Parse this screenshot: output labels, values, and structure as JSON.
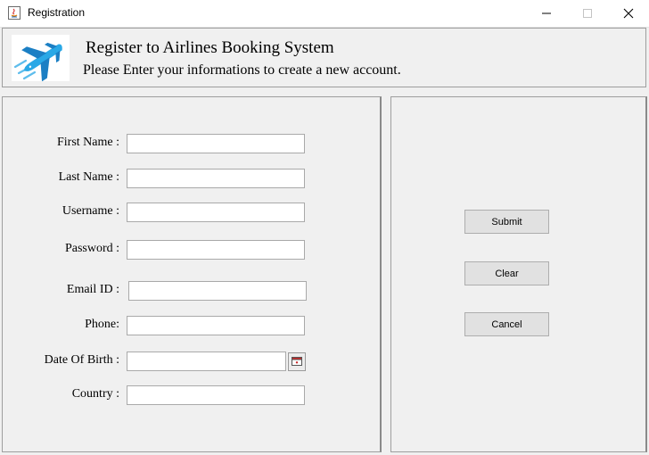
{
  "window": {
    "title": "Registration",
    "icons": {
      "app": "java-app-icon",
      "minimize": "minimize-icon",
      "maximize": "maximize-icon",
      "close": "close-icon"
    }
  },
  "header": {
    "logo": "airplane-logo",
    "title": "Register to Airlines Booking System",
    "subtitle": "Please Enter your informations to create a new account."
  },
  "form": {
    "fields": [
      {
        "label": "First Name :",
        "value": ""
      },
      {
        "label": "Last Name :",
        "value": ""
      },
      {
        "label": "Username :",
        "value": ""
      },
      {
        "label": "Password :",
        "value": ""
      },
      {
        "label": "Email  ID :",
        "value": ""
      },
      {
        "label": "Phone:",
        "value": ""
      },
      {
        "label": "Date Of Birth :",
        "value": ""
      },
      {
        "label": "Country :",
        "value": ""
      }
    ],
    "date_picker_icon": "calendar-icon"
  },
  "actions": {
    "submit": "Submit",
    "clear": "Clear",
    "cancel": "Cancel"
  },
  "colors": {
    "logo_blue": "#29a8e6",
    "logo_dark": "#1b7fc4"
  }
}
